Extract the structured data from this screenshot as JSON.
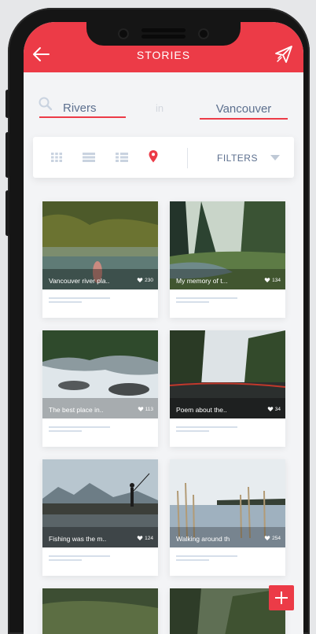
{
  "header": {
    "title": "STORIES",
    "accent": "#ec3b47"
  },
  "search": {
    "topic": "Rivers",
    "connector": "in",
    "place": "Vancouver"
  },
  "toolbar": {
    "filters_label": "FILTERS",
    "active_view": "map-pin"
  },
  "stories": [
    {
      "caption": "Vancouver river pla..",
      "likes": "230"
    },
    {
      "caption": "My memory of t...",
      "likes": "134"
    },
    {
      "caption": "The best place in..",
      "likes": "113"
    },
    {
      "caption": "Poem about the..",
      "likes": "34"
    },
    {
      "caption": "Fishing was the m..",
      "likes": "124"
    },
    {
      "caption": "Walking around th",
      "likes": "254"
    }
  ],
  "icons": [
    "back-arrow-icon",
    "send-icon",
    "search-icon",
    "grid-view-icon",
    "list-view-icon",
    "detail-list-icon",
    "map-pin-icon",
    "chevron-down-icon",
    "heart-icon",
    "plus-icon"
  ]
}
